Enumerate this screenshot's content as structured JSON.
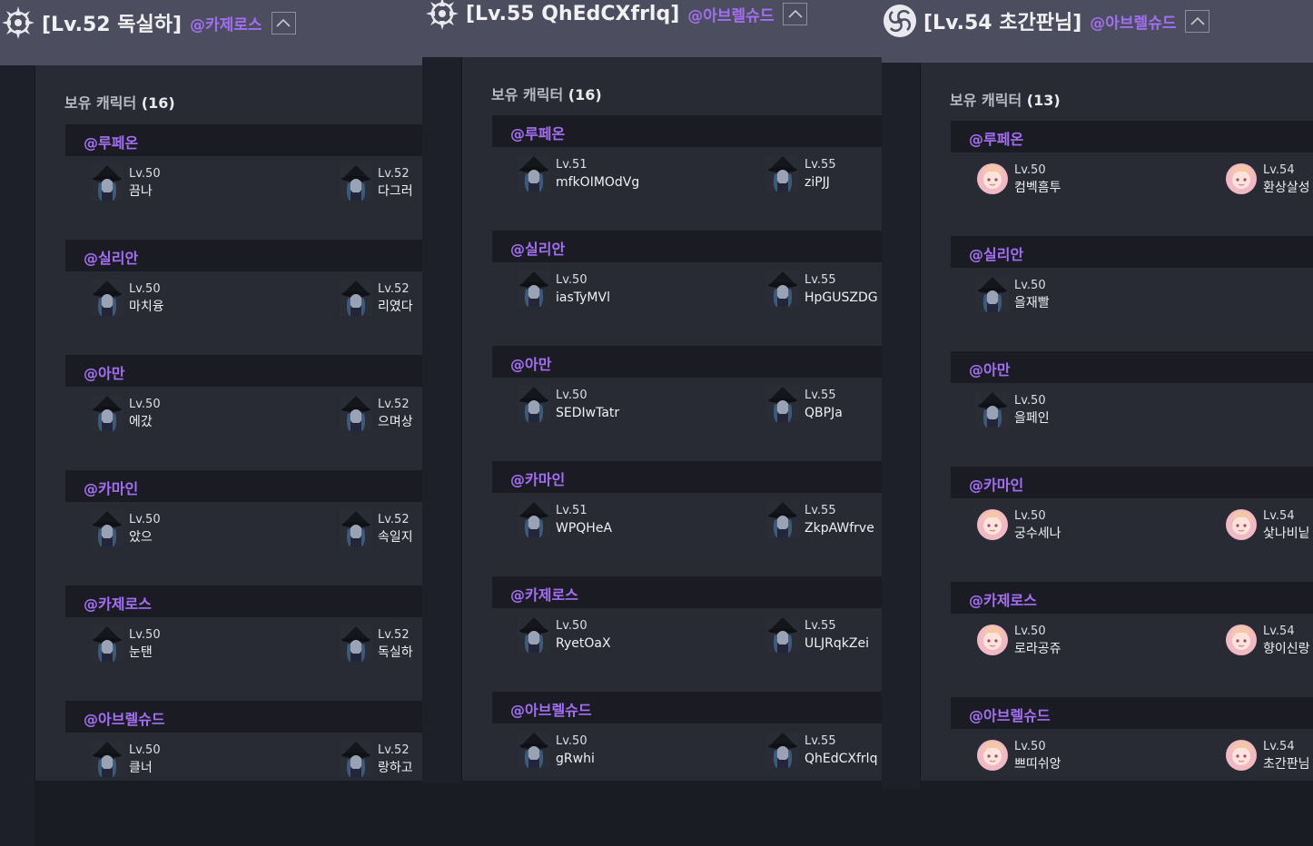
{
  "section_label": "보유 캐릭터",
  "screenshots": [
    {
      "title": "[Lv.52 독실하]",
      "server": "@카제로스",
      "count": "(16)",
      "emblem": "compass-emblem-icon",
      "avatar": "hooded-witch-avatar",
      "groups": [
        {
          "server": "@루페온",
          "chars": [
            {
              "lv": "Lv.50",
              "name": "끔나"
            },
            {
              "lv": "Lv.52",
              "name": "다그러"
            }
          ]
        },
        {
          "server": "@실리안",
          "chars": [
            {
              "lv": "Lv.50",
              "name": "마치융"
            },
            {
              "lv": "Lv.52",
              "name": "리였다"
            }
          ]
        },
        {
          "server": "@아만",
          "chars": [
            {
              "lv": "Lv.50",
              "name": "에갔"
            },
            {
              "lv": "Lv.52",
              "name": "으며상"
            }
          ]
        },
        {
          "server": "@카마인",
          "chars": [
            {
              "lv": "Lv.50",
              "name": "았으"
            },
            {
              "lv": "Lv.52",
              "name": "속일지"
            }
          ]
        },
        {
          "server": "@카제로스",
          "chars": [
            {
              "lv": "Lv.50",
              "name": "눈탠"
            },
            {
              "lv": "Lv.52",
              "name": "독실하"
            }
          ]
        },
        {
          "server": "@아브렐슈드",
          "chars": [
            {
              "lv": "Lv.50",
              "name": "클너"
            },
            {
              "lv": "Lv.52",
              "name": "랑하고"
            }
          ]
        }
      ]
    },
    {
      "title": "[Lv.55 QhEdCXfrlq]",
      "server": "@아브렐슈드",
      "count": "(16)",
      "emblem": "compass-emblem-icon",
      "avatar": "hooded-witch-avatar",
      "groups": [
        {
          "server": "@루페온",
          "chars": [
            {
              "lv": "Lv.51",
              "name": "mfkOIMOdVg"
            },
            {
              "lv": "Lv.55",
              "name": "ziPJJ"
            }
          ]
        },
        {
          "server": "@실리안",
          "chars": [
            {
              "lv": "Lv.50",
              "name": "iasTyMVl"
            },
            {
              "lv": "Lv.55",
              "name": "HpGUSZDG"
            }
          ]
        },
        {
          "server": "@아만",
          "chars": [
            {
              "lv": "Lv.50",
              "name": "SEDIwTatr"
            },
            {
              "lv": "Lv.55",
              "name": "QBPJa"
            }
          ]
        },
        {
          "server": "@카마인",
          "chars": [
            {
              "lv": "Lv.51",
              "name": "WPQHeA"
            },
            {
              "lv": "Lv.55",
              "name": "ZkpAWfrve"
            }
          ]
        },
        {
          "server": "@카제로스",
          "chars": [
            {
              "lv": "Lv.50",
              "name": "RyetOaX"
            },
            {
              "lv": "Lv.55",
              "name": "ULJRqkZei"
            }
          ]
        },
        {
          "server": "@아브렐슈드",
          "chars": [
            {
              "lv": "Lv.50",
              "name": "gRwhi"
            },
            {
              "lv": "Lv.55",
              "name": "QhEdCXfrlq"
            }
          ]
        }
      ]
    },
    {
      "title": "[Lv.54 초간판님]",
      "server": "@아브렐슈드",
      "count": "(13)",
      "emblem": "swirl-emblem-icon",
      "avatar": "pink-hair-girl-avatar",
      "groups": [
        {
          "server": "@루페온",
          "chars": [
            {
              "lv": "Lv.50",
              "name": "컴벡흠투"
            },
            {
              "lv": "Lv.54",
              "name": "환상살성"
            }
          ]
        },
        {
          "server": "@실리안",
          "chars": [
            {
              "lv": "Lv.50",
              "name": "을재빨",
              "avatar": "hooded-witch-avatar"
            }
          ]
        },
        {
          "server": "@아만",
          "chars": [
            {
              "lv": "Lv.50",
              "name": "을페인",
              "avatar": "hooded-witch-avatar"
            }
          ]
        },
        {
          "server": "@카마인",
          "chars": [
            {
              "lv": "Lv.50",
              "name": "궁수세나"
            },
            {
              "lv": "Lv.54",
              "name": "샃나비닡"
            }
          ]
        },
        {
          "server": "@카제로스",
          "chars": [
            {
              "lv": "Lv.50",
              "name": "로라공쥬"
            },
            {
              "lv": "Lv.54",
              "name": "향이신랑"
            }
          ]
        },
        {
          "server": "@아브렐슈드",
          "chars": [
            {
              "lv": "Lv.50",
              "name": "쁘띠쉬앙"
            },
            {
              "lv": "Lv.54",
              "name": "초간판님"
            }
          ]
        }
      ]
    }
  ],
  "colors": {
    "accent": "#a46ff5",
    "header": "#4c4e5f",
    "panel": "#282a34",
    "bar": "#1b1c23"
  }
}
